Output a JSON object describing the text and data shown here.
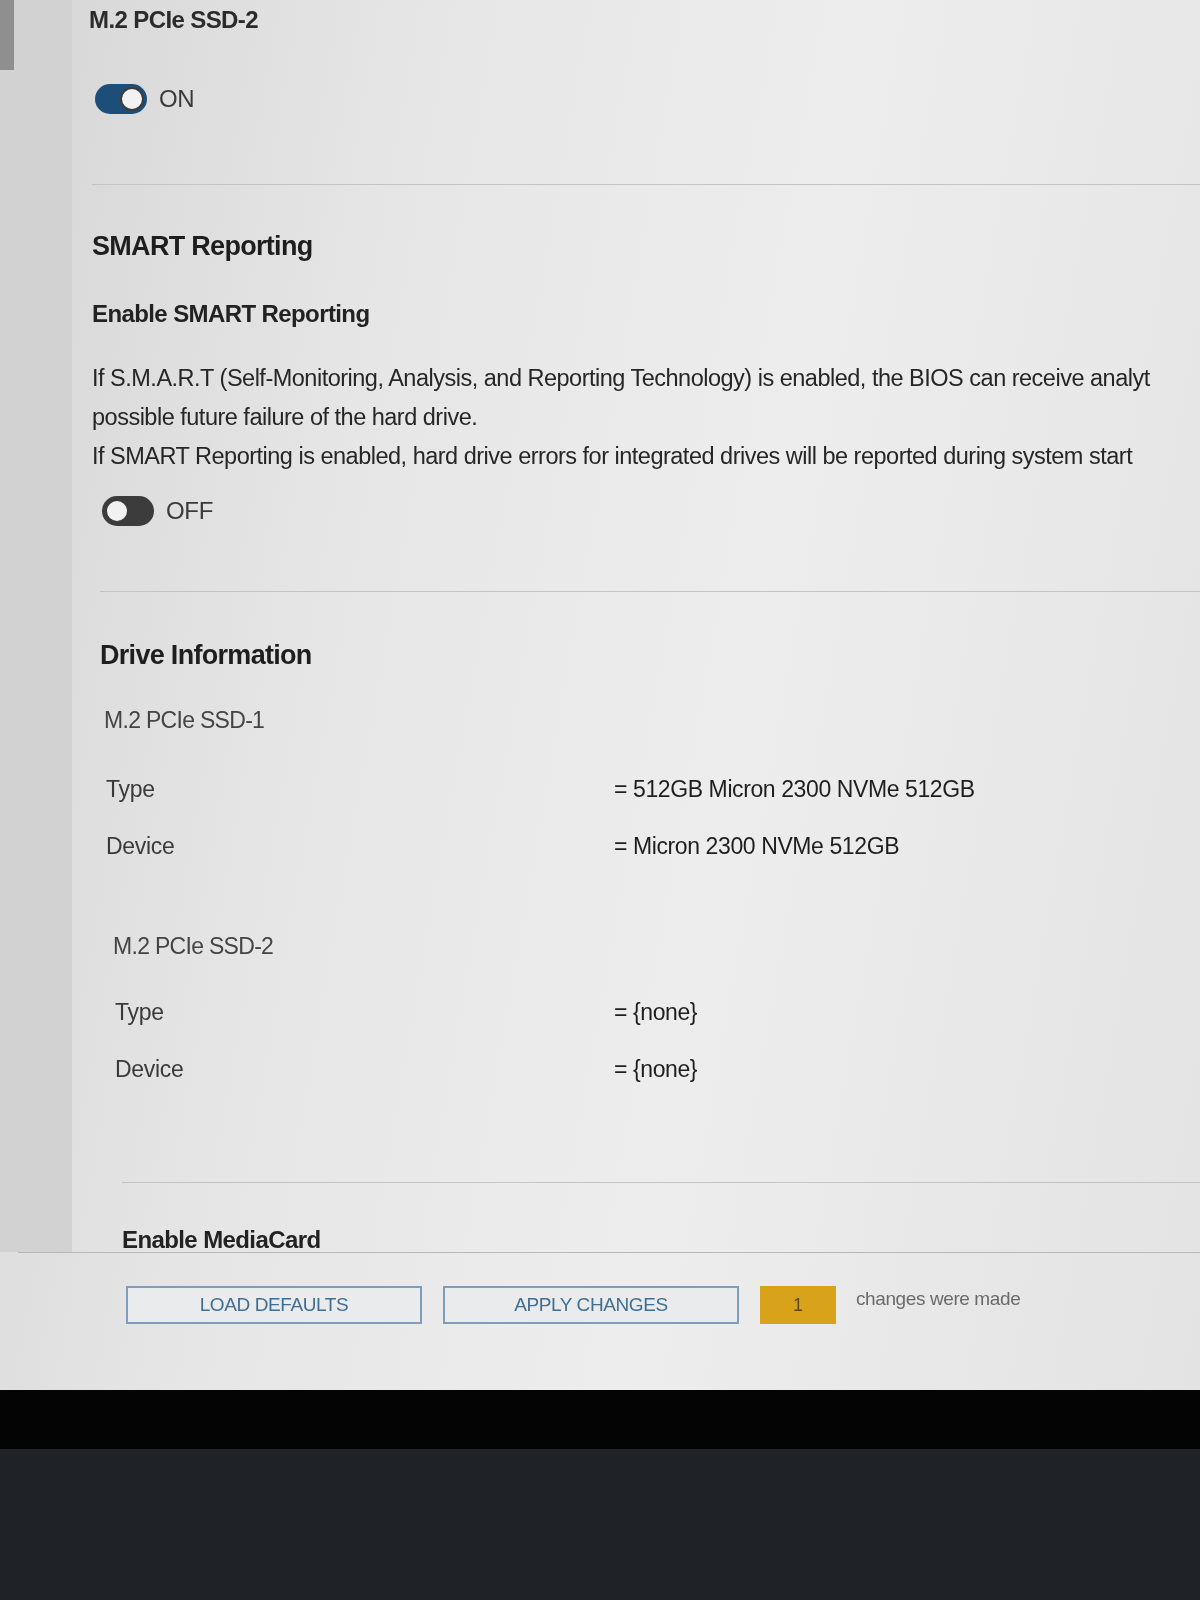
{
  "device_toggle": {
    "title": "M.2 PCIe SSD-2",
    "on": true,
    "label": "ON"
  },
  "smart_reporting": {
    "heading": "SMART Reporting",
    "setting": {
      "title": "Enable SMART Reporting",
      "description_lines": [
        "If S.M.A.R.T (Self-Monitoring, Analysis, and Reporting Technology) is enabled, the BIOS can receive analyt",
        "possible future failure of the hard drive.",
        "If SMART Reporting is enabled, hard drive errors for integrated drives will be reported during system start"
      ],
      "on": false,
      "label": "OFF"
    }
  },
  "drive_information": {
    "heading": "Drive Information",
    "drives": [
      {
        "name": "M.2 PCIe SSD-1",
        "fields": [
          {
            "label": "Type",
            "value": "= 512GB Micron 2300 NVMe 512GB"
          },
          {
            "label": "Device",
            "value": "= Micron 2300 NVMe 512GB"
          }
        ]
      },
      {
        "name": "M.2 PCIe SSD-2",
        "fields": [
          {
            "label": "Type",
            "value": "= {none}"
          },
          {
            "label": "Device",
            "value": "= {none}"
          }
        ]
      }
    ]
  },
  "next_section": {
    "title": "Enable MediaCard"
  },
  "footer": {
    "buttons": [
      "LOAD DEFAULTS",
      "APPLY CHANGES"
    ],
    "change_count": "1",
    "change_text": "changes were made"
  }
}
